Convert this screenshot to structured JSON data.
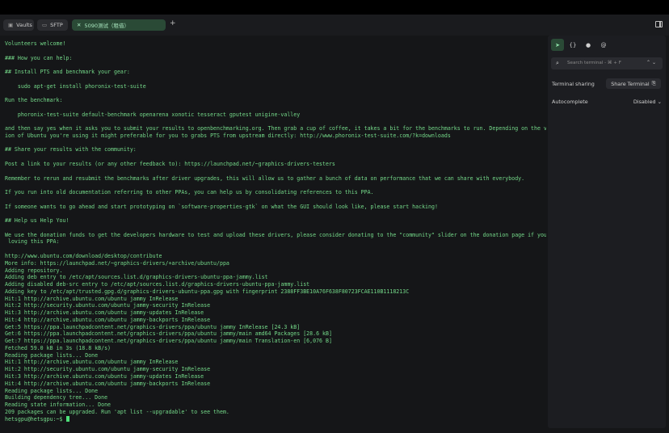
{
  "tabs": [
    {
      "label": "Vaults",
      "icon": "vault-icon"
    },
    {
      "label": "SFTP",
      "icon": "folder-icon"
    },
    {
      "label": "5090测试（租借）",
      "icon": "close-icon"
    }
  ],
  "panel": {
    "search_placeholder": "Search terminal - ⌘ + F",
    "terminal_sharing_label": "Terminal sharing",
    "share_button_label": "Share Terminal",
    "autocomplete_label": "Autocomplete",
    "autocomplete_value": "Disabled"
  },
  "colors": {
    "accent": "#2a4a36",
    "terminal_text": "#74d989",
    "background": "#151618"
  },
  "terminal": {
    "lines": [
      "Volunteers welcome!",
      "",
      "### How you can help:",
      "",
      "## Install PTS and benchmark your gear:",
      "",
      "    sudo apt-get install phoronix-test-suite",
      "",
      "Run the benchmark:",
      "",
      "    phoronix-test-suite default-benchmark openarena xonotic tesseract gputest unigine-valley",
      "",
      "and then say yes when it asks you to submit your results to openbenchmarking.org. Then grab a cup of coffee, it takes a bit for the benchmarks to run. Depending on the ver",
      "ion of Ubuntu you're using it might preferable for you to grabs PTS from upstream directly: http://www.phoronix-test-suite.com/?k=downloads",
      "",
      "## Share your results with the community:",
      "",
      "Post a link to your results (or any other feedback to): https://launchpad.net/~graphics-drivers-testers",
      "",
      "Remember to rerun and resubmit the benchmarks after driver upgrades, this will allow us to gather a bunch of data on performance that we can share with everybody.",
      "",
      "If you run into old documentation referring to other PPAs, you can help us by consolidating references to this PPA.",
      "",
      "If someone wants to go ahead and start prototyping on `software-properties-gtk` on what the GUI should look like, please start hacking!",
      "",
      "## Help us Help You!",
      "",
      "We use the donation funds to get the developers hardware to test and upload these drivers, please consider donating to the \"community\" slider on the donation page if you're",
      " loving this PPA:",
      "",
      "http://www.ubuntu.com/download/desktop/contribute",
      "More info: https://launchpad.net/~graphics-drivers/+archive/ubuntu/ppa",
      "Adding repository.",
      "Adding deb entry to /etc/apt/sources.list.d/graphics-drivers-ubuntu-ppa-jammy.list",
      "Adding disabled deb-src entry to /etc/apt/sources.list.d/graphics-drivers-ubuntu-ppa-jammy.list",
      "Adding key to /etc/apt/trusted.gpg.d/graphics-drivers-ubuntu-ppa.gpg with fingerprint 2388FF3BE10A76F638F80723FCAE110B1118213C",
      "Hit:1 http://archive.ubuntu.com/ubuntu jammy InRelease",
      "Hit:2 http://security.ubuntu.com/ubuntu jammy-security InRelease",
      "Hit:3 http://archive.ubuntu.com/ubuntu jammy-updates InRelease",
      "Hit:4 http://archive.ubuntu.com/ubuntu jammy-backports InRelease",
      "Get:5 https://ppa.launchpadcontent.net/graphics-drivers/ppa/ubuntu jammy InRelease [24.3 kB]",
      "Get:6 https://ppa.launchpadcontent.net/graphics-drivers/ppa/ubuntu jammy/main amd64 Packages [28.6 kB]",
      "Get:7 https://ppa.launchpadcontent.net/graphics-drivers/ppa/ubuntu jammy/main Translation-en [6,076 B]",
      "Fetched 59.0 kB in 3s (18.8 kB/s)",
      "Reading package lists... Done",
      "Hit:1 http://archive.ubuntu.com/ubuntu jammy InRelease",
      "Hit:2 http://security.ubuntu.com/ubuntu jammy-security InRelease",
      "Hit:3 http://archive.ubuntu.com/ubuntu jammy-updates InRelease",
      "Hit:4 http://archive.ubuntu.com/ubuntu jammy-backports InRelease",
      "Reading package lists... Done",
      "Building dependency tree... Done",
      "Reading state information... Done",
      "209 packages can be upgraded. Run 'apt list --upgradable' to see them."
    ],
    "prompt": "hetsgpu@hetsgpu:~$ "
  }
}
